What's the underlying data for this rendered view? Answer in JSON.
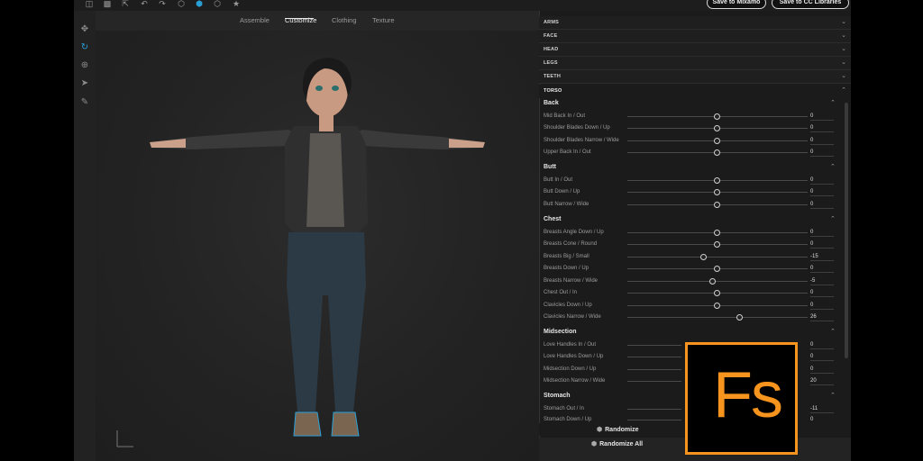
{
  "toolbar": {
    "icons": [
      "import-icon",
      "save-icon",
      "export-icon",
      "undo-icon",
      "redo-icon",
      "cube-icon",
      "cube-color-icon",
      "cube-outline-icon",
      "star-icon"
    ],
    "save_mixamo": "Save to Mixamo",
    "save_cc": "Save to CC Libraries"
  },
  "tools": [
    "move-tool",
    "orbit-tool",
    "target-tool",
    "select-tool",
    "annotate-tool"
  ],
  "tabs": [
    {
      "label": "Assemble"
    },
    {
      "label": "Customize",
      "active": true
    },
    {
      "label": "Clothing"
    },
    {
      "label": "Texture"
    }
  ],
  "panel": {
    "collapsed": [
      {
        "label": "ARMS"
      },
      {
        "label": "FACE"
      },
      {
        "label": "HEAD"
      },
      {
        "label": "LEGS"
      },
      {
        "label": "TEETH"
      }
    ],
    "torso_label": "TORSO",
    "sections": [
      {
        "label": "Back",
        "sliders": [
          {
            "label": "Mid Back In / Out",
            "value": "0"
          },
          {
            "label": "Shoulder Blades Down / Up",
            "value": "0"
          },
          {
            "label": "Shoulder Blades Narrow / Wide",
            "value": "0"
          },
          {
            "label": "Upper Back In / Out",
            "value": "0"
          }
        ]
      },
      {
        "label": "Butt",
        "sliders": [
          {
            "label": "Butt In / Out",
            "value": "0"
          },
          {
            "label": "Butt Down / Up",
            "value": "0"
          },
          {
            "label": "Butt Narrow / Wide",
            "value": "0"
          }
        ]
      },
      {
        "label": "Chest",
        "sliders": [
          {
            "label": "Breasts Angle Down / Up",
            "value": "0"
          },
          {
            "label": "Breasts Cone / Round",
            "value": "0"
          },
          {
            "label": "Breasts Big / Small",
            "value": "-15"
          },
          {
            "label": "Breasts Down / Up",
            "value": "0"
          },
          {
            "label": "Breasts Narrow / Wide",
            "value": "-5"
          },
          {
            "label": "Chest Out / In",
            "value": "0"
          },
          {
            "label": "Clavicles Down / Up",
            "value": "0"
          },
          {
            "label": "Clavicles Narrow / Wide",
            "value": "26"
          }
        ]
      },
      {
        "label": "Midsection",
        "sliders": [
          {
            "label": "Love Handles In / Out",
            "value": "0"
          },
          {
            "label": "Love Handles Down / Up",
            "value": "0"
          },
          {
            "label": "Midsection Down / Up",
            "value": "0"
          },
          {
            "label": "Midsection Narrow / Wide",
            "value": "20"
          }
        ]
      },
      {
        "label": "Stomach",
        "sliders": [
          {
            "label": "Stomach Out / In",
            "value": "-11"
          },
          {
            "label": "Stomach Down / Up",
            "value": "0"
          }
        ]
      }
    ],
    "randomize": "Randomize",
    "randomize_all": "Randomize All"
  },
  "logo": {
    "text": "Fs",
    "color": "#f7941d"
  },
  "colors": {
    "accent": "#2a9fd6",
    "logo_border": "#f7941d"
  }
}
